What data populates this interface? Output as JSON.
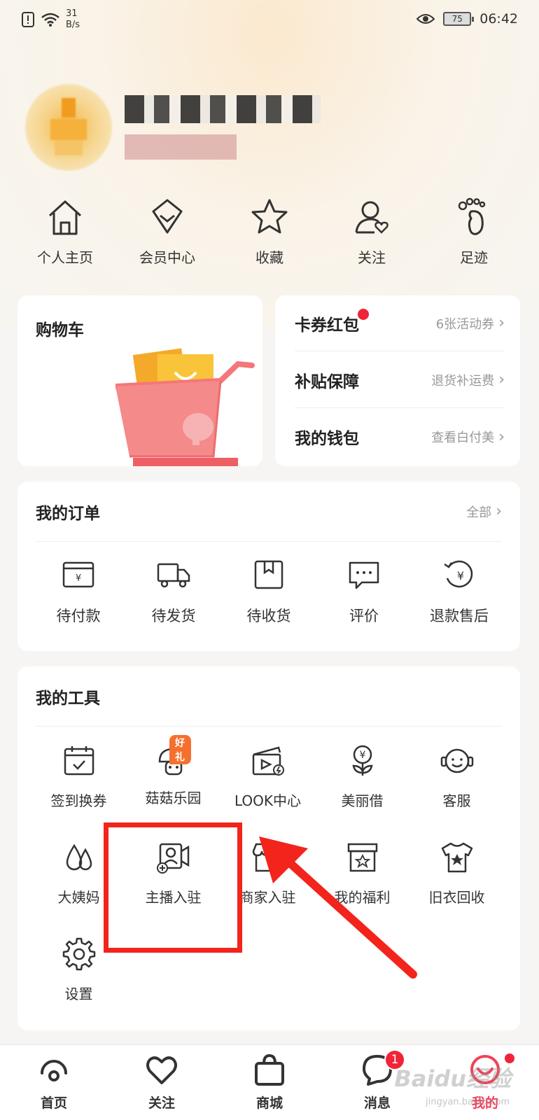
{
  "status_bar": {
    "speed_value": "31",
    "speed_unit": "B/s",
    "battery": "75",
    "time": "06:42"
  },
  "quick_nav": [
    {
      "label": "个人主页",
      "icon": "home-icon"
    },
    {
      "label": "会员中心",
      "icon": "diamond-icon"
    },
    {
      "label": "收藏",
      "icon": "star-icon"
    },
    {
      "label": "关注",
      "icon": "person-heart-icon"
    },
    {
      "label": "足迹",
      "icon": "footprint-icon"
    }
  ],
  "cart": {
    "title": "购物车"
  },
  "wallet": [
    {
      "title": "卡券红包",
      "hint": "6张活动券",
      "dot": true
    },
    {
      "title": "补贴保障",
      "hint": "退货补运费"
    },
    {
      "title": "我的钱包",
      "hint": "查看白付美"
    }
  ],
  "orders": {
    "title": "我的订单",
    "more": "全部",
    "items": [
      {
        "label": "待付款",
        "icon": "wallet-icon"
      },
      {
        "label": "待发货",
        "icon": "truck-icon"
      },
      {
        "label": "待收货",
        "icon": "package-icon"
      },
      {
        "label": "评价",
        "icon": "comment-icon"
      },
      {
        "label": "退款售后",
        "icon": "refund-icon"
      }
    ]
  },
  "tools": {
    "title": "我的工具",
    "items": [
      {
        "label": "签到换券",
        "icon": "calendar-check-icon"
      },
      {
        "label": "菇菇乐园",
        "icon": "mushroom-icon",
        "badge": "好礼"
      },
      {
        "label": "LOOK中心",
        "icon": "clapper-icon"
      },
      {
        "label": "美丽借",
        "icon": "yen-flower-icon"
      },
      {
        "label": "客服",
        "icon": "headset-icon"
      },
      {
        "label": "大姨妈",
        "icon": "drops-icon"
      },
      {
        "label": "主播入驻",
        "icon": "streamer-add-icon"
      },
      {
        "label": "商家入驻",
        "icon": "shop-add-icon"
      },
      {
        "label": "我的福利",
        "icon": "gift-box-icon"
      },
      {
        "label": "旧衣回收",
        "icon": "tshirt-star-icon"
      },
      {
        "label": "设置",
        "icon": "gear-icon"
      }
    ]
  },
  "bottom_nav": [
    {
      "label": "首页",
      "icon": "home-swirl-icon"
    },
    {
      "label": "关注",
      "icon": "heart-icon"
    },
    {
      "label": "商城",
      "icon": "bag-icon"
    },
    {
      "label": "消息",
      "icon": "chat-bubble-icon",
      "badge": "1"
    },
    {
      "label": "我的",
      "icon": "smile-profile-icon",
      "active": true
    }
  ],
  "watermark": {
    "text": "Baidu经验",
    "sub": "jingyan.baidu.com"
  },
  "colors": {
    "accent": "#f0425a",
    "badge_red": "#f02438",
    "highlight": "#f2241b"
  }
}
